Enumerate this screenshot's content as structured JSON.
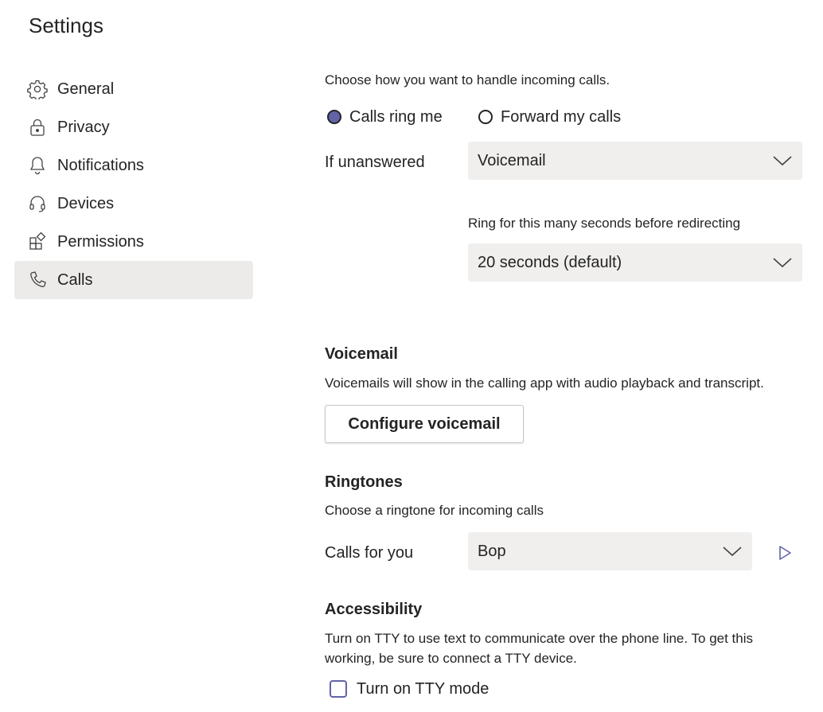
{
  "page": {
    "title": "Settings"
  },
  "sidebar": {
    "items": [
      {
        "label": "General",
        "icon": "gear-icon"
      },
      {
        "label": "Privacy",
        "icon": "lock-icon"
      },
      {
        "label": "Notifications",
        "icon": "bell-icon"
      },
      {
        "label": "Devices",
        "icon": "headset-icon"
      },
      {
        "label": "Permissions",
        "icon": "apps-icon"
      },
      {
        "label": "Calls",
        "icon": "phone-icon",
        "active": true
      }
    ]
  },
  "calls": {
    "intro": "Choose how you want to handle incoming calls.",
    "radio_ring": "Calls ring me",
    "radio_forward": "Forward my calls",
    "selected_option": "Calls ring me",
    "unanswered_label": "If unanswered",
    "unanswered_value": "Voicemail",
    "ring_label": "Ring for this many seconds before redirecting",
    "ring_value": "20 seconds (default)"
  },
  "voicemail": {
    "heading": "Voicemail",
    "description": "Voicemails will show in the calling app with audio playback and transcript.",
    "button": "Configure voicemail"
  },
  "ringtones": {
    "heading": "Ringtones",
    "description": "Choose a ringtone for incoming calls",
    "calls_for_you_label": "Calls for you",
    "calls_for_you_value": "Bop"
  },
  "accessibility": {
    "heading": "Accessibility",
    "description_line1": "Turn on TTY to use text to communicate over the phone line. To get this",
    "description_line2": "working, be sure to connect a TTY device.",
    "tty_label": "Turn on TTY mode",
    "tty_checked": false
  },
  "colors": {
    "accent": "#6264a7",
    "active_bg": "#edebe9",
    "select_bg": "#f0efee",
    "text": "#242424"
  }
}
